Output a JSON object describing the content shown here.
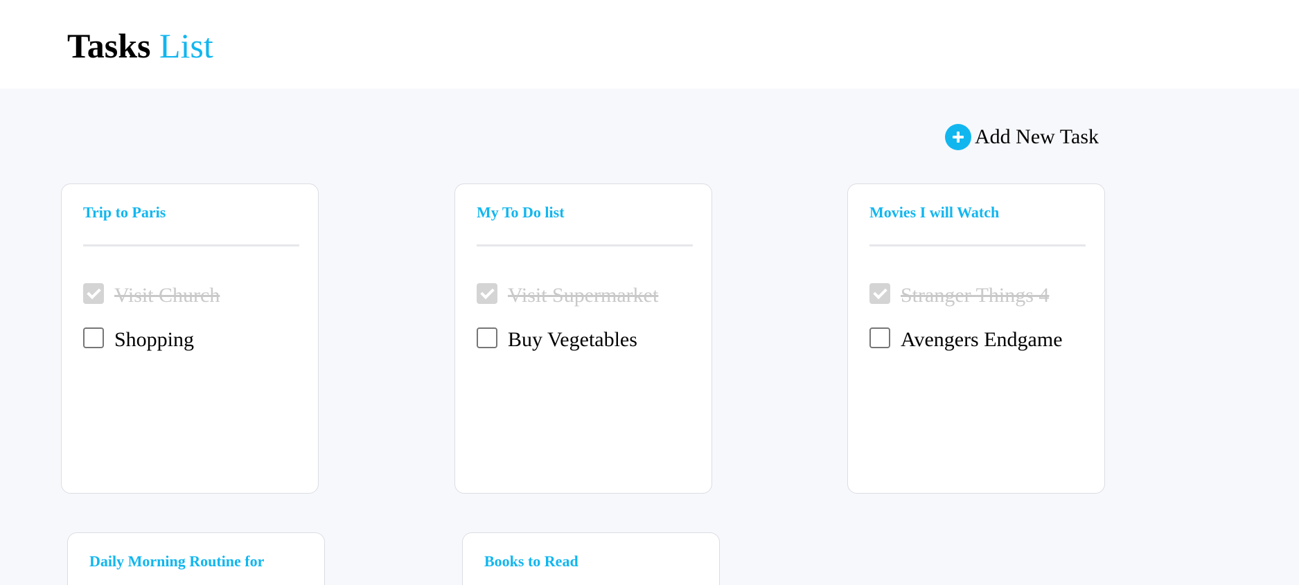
{
  "header": {
    "title_main": "Tasks",
    "title_accent": "List"
  },
  "add_task": {
    "icon": "plus-circle-icon",
    "label": "Add New Task"
  },
  "colors": {
    "accent": "#11b6ef",
    "background": "#f7f8fc",
    "card_border": "#dcdde3",
    "done_text": "#c9c9c9"
  },
  "cards": [
    {
      "title": "Trip to Paris",
      "tasks": [
        {
          "label": "Visit Church",
          "done": true
        },
        {
          "label": "Shopping",
          "done": false
        }
      ]
    },
    {
      "title": "My To Do list",
      "tasks": [
        {
          "label": "Visit Supermarket",
          "done": true
        },
        {
          "label": "Buy Vegetables",
          "done": false
        }
      ]
    },
    {
      "title": "Movies I will Watch",
      "tasks": [
        {
          "label": "Stranger Things 4",
          "done": true
        },
        {
          "label": "Avengers Endgame",
          "done": false
        }
      ]
    },
    {
      "title": "Daily Morning Routine for",
      "tasks": []
    },
    {
      "title": "Books to Read",
      "tasks": []
    }
  ]
}
